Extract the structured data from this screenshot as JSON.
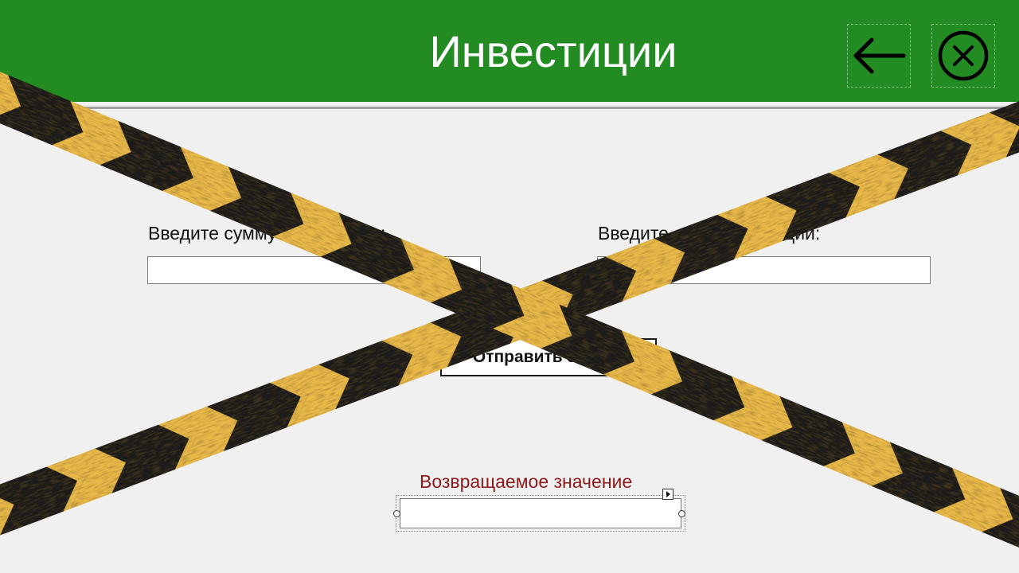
{
  "window": {
    "title": "Инвестиции"
  },
  "form": {
    "amount_label": "Введите сумму инвестиции:",
    "amount_value": "",
    "term_label": "Введите срок инвестиции:",
    "term_value": "",
    "submit_label": "Отправить запрос"
  },
  "result": {
    "label": "Возвращаемое значение",
    "value": ""
  },
  "icons": {
    "back": "arrow-left-icon",
    "close": "circle-x-icon",
    "overlay": "caution-tape"
  },
  "colors": {
    "header": "#228b22",
    "background": "#f0f0f0",
    "result_label": "#8b1a1a",
    "tape_yellow": "#e8b84a",
    "tape_black": "#1e1e1c"
  }
}
